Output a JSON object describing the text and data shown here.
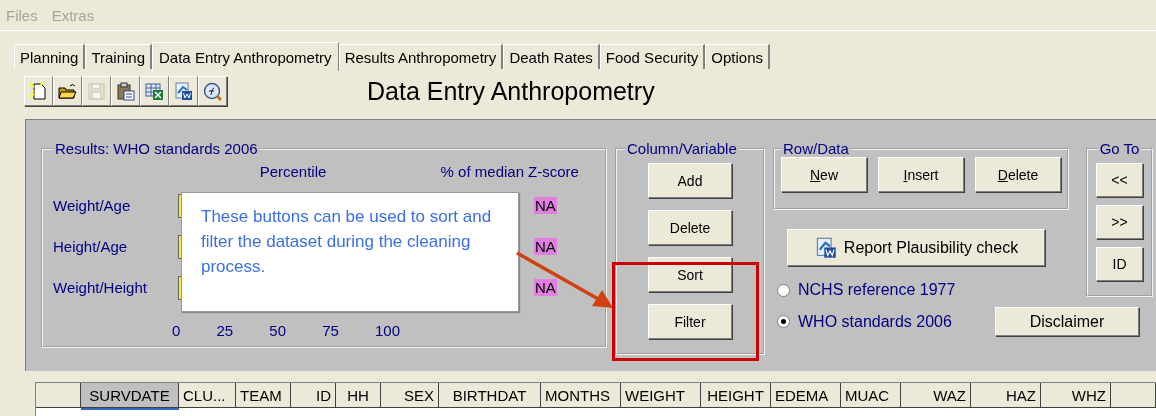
{
  "menu": [
    {
      "label": "Files",
      "disabled": true
    },
    {
      "label": "Extras",
      "disabled": true
    }
  ],
  "tabs": [
    {
      "label": "Planning",
      "selected": false
    },
    {
      "label": "Training",
      "selected": false
    },
    {
      "label": "Data Entry Anthropometry",
      "selected": true
    },
    {
      "label": "Results Anthropometry",
      "selected": false
    },
    {
      "label": "Death Rates",
      "selected": false
    },
    {
      "label": "Food Security",
      "selected": false
    },
    {
      "label": "Options",
      "selected": false
    }
  ],
  "toolbar": {
    "buttons": [
      {
        "kind": "new",
        "disabled": false
      },
      {
        "kind": "open",
        "disabled": false
      },
      {
        "kind": "save",
        "disabled": true
      },
      {
        "kind": "paste",
        "disabled": false
      },
      {
        "kind": "excel",
        "disabled": false
      },
      {
        "kind": "word",
        "disabled": false
      },
      {
        "kind": "formula",
        "disabled": false
      }
    ],
    "title": "Data Entry Anthropometry"
  },
  "results": {
    "title": "Results: WHO standards 2006",
    "percentile_label": "Percentile",
    "median_label": "% of median",
    "zscore_label": "Z-score",
    "rows": [
      {
        "label": "Weight/Age",
        "zscore": "NA"
      },
      {
        "label": "Height/Age",
        "zscore": "NA"
      },
      {
        "label": "Weight/Height",
        "zscore": "NA"
      }
    ],
    "axis": [
      "0",
      "25",
      "50",
      "75",
      "100"
    ]
  },
  "column_variable": {
    "title": "Column/Variable",
    "buttons": [
      "Add",
      "Delete",
      "Sort",
      "Filter"
    ]
  },
  "row_data": {
    "title": "Row/Data",
    "buttons": [
      {
        "label": "New",
        "mnemonic": true
      },
      {
        "label": "Insert",
        "mnemonic": true
      },
      {
        "label": "Delete",
        "mnemonic": true
      }
    ]
  },
  "go_to": {
    "title": "Go To",
    "buttons": [
      "<<",
      ">>",
      "ID"
    ]
  },
  "report_button": "Report Plausibility check",
  "standards": [
    {
      "label": "NCHS reference 1977",
      "selected": false
    },
    {
      "label": "WHO standards 2006",
      "selected": true
    }
  ],
  "disclaimer_button": "Disclaimer",
  "grid": {
    "columns": [
      {
        "label": "SURVDATE",
        "selected": true
      },
      {
        "label": "CLU...",
        "selected": false
      },
      {
        "label": "TEAM",
        "selected": false
      },
      {
        "label": "ID",
        "selected": false
      },
      {
        "label": "HH",
        "selected": false
      },
      {
        "label": "SEX",
        "selected": false
      },
      {
        "label": "BIRTHDAT",
        "selected": false
      },
      {
        "label": "MONTHS",
        "selected": false
      },
      {
        "label": "WEIGHT",
        "selected": false
      },
      {
        "label": "HEIGHT",
        "selected": false
      },
      {
        "label": "EDEMA",
        "selected": false
      },
      {
        "label": "MUAC",
        "selected": false
      },
      {
        "label": "WAZ",
        "selected": false
      },
      {
        "label": "HAZ",
        "selected": false
      },
      {
        "label": "WHZ",
        "selected": false
      }
    ]
  },
  "callout": {
    "text": "These buttons can be used to sort and filter the dataset during the cleaning process."
  }
}
